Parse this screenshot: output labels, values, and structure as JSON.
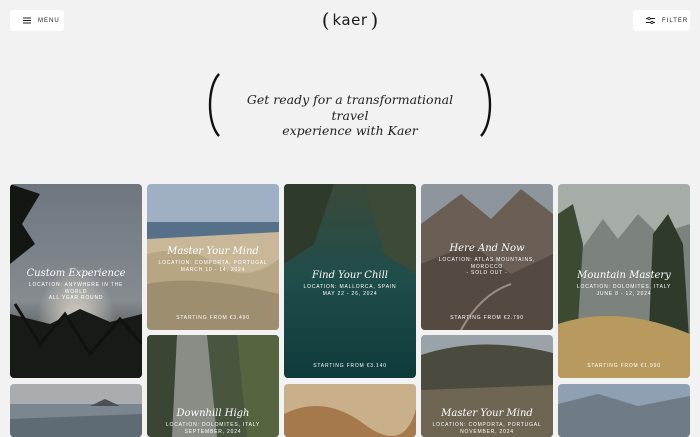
{
  "header": {
    "menu_label": "MENU",
    "filter_label": "FILTER",
    "logo_text": "kaer",
    "logo_left": "(",
    "logo_right": ")"
  },
  "hero": {
    "line1": "Get ready for a transformational travel",
    "line2": "experience with Kaer"
  },
  "cards": {
    "custom": {
      "title": "Custom Experience",
      "meta1": "LOCATION: ANYWHERE IN THE",
      "meta2": "WORLD",
      "meta3": "ALL YEAR ROUND"
    },
    "mastermind1": {
      "title": "Master Your Mind",
      "meta1": "LOCATION: COMPORTA, PORTUGAL",
      "meta2": "MARCH 10 - 14, 2024",
      "price": "STARTING FROM €3.490"
    },
    "chill": {
      "title": "Find Your Chill",
      "meta1": "LOCATION: MALLORCA, SPAIN",
      "meta2": "MAY 22 - 26, 2024",
      "price": "STARTING FROM €3.140"
    },
    "herenow": {
      "title": "Here And Now",
      "meta1": "LOCATION: ATLAS MOUNTAINS,",
      "meta2": "MOROCCO",
      "meta3": "- SOLD OUT -",
      "price": "STARTING FROM €2.790"
    },
    "mountain": {
      "title": "Mountain Mastery",
      "meta1": "LOCATION: DOLOMITES, ITALY",
      "meta2": "JUNE 8 - 12, 2024",
      "price": "STARTING FROM €1.990"
    },
    "downhill": {
      "title": "Downhill High",
      "meta1": "LOCATION: DOLOMITES, ITALY",
      "meta2": "SEPTEMBER, 2024"
    },
    "mastermind2": {
      "title": "Master Your Mind",
      "meta1": "LOCATION: COMPORTA, PORTUGAL",
      "meta2": "NOVEMBER, 2024"
    }
  },
  "icons": {
    "menu": "menu-icon",
    "filter": "sliders-icon"
  }
}
